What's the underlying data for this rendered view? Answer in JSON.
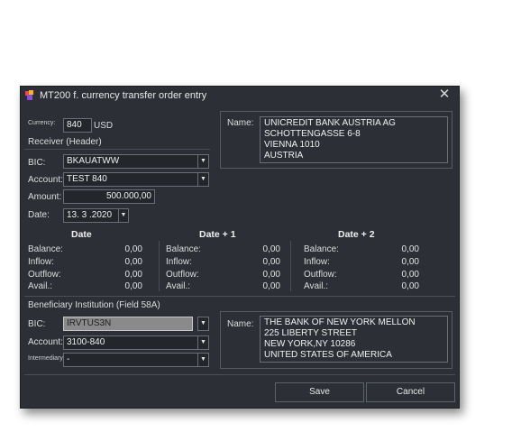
{
  "window": {
    "title": "MT200 f. currency transfer order entry",
    "close_glyph": "✕"
  },
  "currency": {
    "label": "Currency:",
    "value": "840",
    "unit": "USD"
  },
  "receiver": {
    "section_label": "Receiver (Header)",
    "bic_label": "BIC:",
    "bic_value": "BKAUATWW",
    "account_label": "Account:",
    "account_value": "TEST 840",
    "amount_label": "Amount:",
    "amount_value": "500.000,00",
    "date_label": "Date:",
    "date_value": "13. 3 .2020",
    "name_label": "Name:",
    "name_lines": [
      "UNICREDIT BANK AUSTRIA AG",
      "SCHOTTENGASSE 6-8",
      "VIENNA 1010",
      "AUSTRIA"
    ]
  },
  "balances": {
    "columns": [
      {
        "header": "Date",
        "rows": [
          {
            "label": "Balance:",
            "value": "0,00"
          },
          {
            "label": "Inflow:",
            "value": "0,00"
          },
          {
            "label": "Outflow:",
            "value": "0,00"
          },
          {
            "label": "Avail.:",
            "value": "0,00"
          }
        ]
      },
      {
        "header": "Date + 1",
        "rows": [
          {
            "label": "Balance:",
            "value": "0,00"
          },
          {
            "label": "Inflow:",
            "value": "0,00"
          },
          {
            "label": "Outflow:",
            "value": "0,00"
          },
          {
            "label": "Avail.:",
            "value": "0,00"
          }
        ]
      },
      {
        "header": "Date + 2",
        "rows": [
          {
            "label": "Balance:",
            "value": "0,00"
          },
          {
            "label": "Inflow:",
            "value": "0,00"
          },
          {
            "label": "Outflow:",
            "value": "0,00"
          },
          {
            "label": "Avail.:",
            "value": "0,00"
          }
        ]
      }
    ]
  },
  "beneficiary": {
    "section_label": "Beneficiary Institution (Field 58A)",
    "bic_label": "BIC:",
    "bic_value": "IRVTUS3N",
    "account_label": "Account:",
    "account_value": "3100-840",
    "intermediary_label": "Intermediary:",
    "intermediary_value": "-",
    "name_label": "Name:",
    "name_lines": [
      "THE BANK OF NEW YORK MELLON",
      "225 LIBERTY STREET",
      "NEW YORK,NY 10286",
      "UNITED STATES OF AMERICA"
    ]
  },
  "buttons": {
    "save": "Save",
    "cancel": "Cancel"
  },
  "icons": {
    "app": "app-logo-icon",
    "dropdown": "chevron-down-icon",
    "close": "close-icon"
  }
}
